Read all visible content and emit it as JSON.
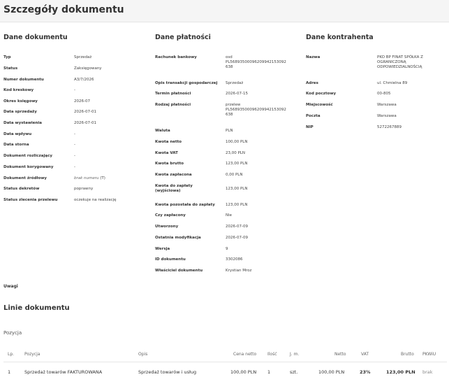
{
  "page": {
    "title": "Szczegóły dokumentu"
  },
  "document": {
    "title": "Dane dokumentu",
    "fields": [
      {
        "label": "Typ",
        "value": "Sprzedaż"
      },
      {
        "label": "Status",
        "value": "Zaksięgowany"
      },
      {
        "label": "Numer dokumentu",
        "value": "A3/7/2026"
      },
      {
        "label": "Kod kreskowy",
        "value": "-"
      },
      {
        "label": "Okres księgowy",
        "value": "2026-07"
      },
      {
        "label": "Data sprzedaży",
        "value": "2026-07-01"
      },
      {
        "label": "Data wystawienia",
        "value": "2026-07-01"
      },
      {
        "label": "Data wpływu",
        "value": "-"
      },
      {
        "label": "Data storna",
        "value": "-"
      },
      {
        "label": "Dokument rozliczający",
        "value": "-"
      },
      {
        "label": "Dokument korygowany",
        "value": "-"
      },
      {
        "label": "Dokument źródłowy",
        "value_italic": "brak numeru",
        "value_suffix": " (T)"
      },
      {
        "label": "Status dekretów",
        "value": "poprawny"
      },
      {
        "label": "Status zlecenia przelewu",
        "value": "oczekuje na realizację"
      }
    ]
  },
  "payment": {
    "title": "Dane płatności",
    "fields": [
      {
        "label": "Rachunek bankowy",
        "value": [
          "osd",
          "PL56893500096209942153092",
          "638"
        ]
      },
      {
        "label": "Opis transakcji gospodarczej",
        "value": [
          "Sprzedaż"
        ]
      },
      {
        "label": "Termin płatności",
        "value": [
          "2026-07-15"
        ]
      },
      {
        "label": "Rodzaj płatności",
        "value": [
          "przelew",
          "PL56893500096209942153092",
          "638"
        ]
      },
      {
        "label": "Waluta",
        "value": [
          "PLN"
        ]
      },
      {
        "label": "Kwota netto",
        "value": [
          "100,00 PLN"
        ]
      },
      {
        "label": "Kwota VAT",
        "value": [
          "23,00 PLN"
        ]
      },
      {
        "label": "Kwota brutto",
        "value": [
          "123,00 PLN"
        ]
      },
      {
        "label": "Kwota zapłacona",
        "value": [
          "0,00 PLN"
        ]
      },
      {
        "label": "Kwota do zapłaty (wyjściowa)",
        "value": [
          "123,00 PLN"
        ]
      },
      {
        "label": "Kwota pozostała do zapłaty",
        "value": [
          "123,00 PLN"
        ]
      },
      {
        "label": "Czy zapłacony",
        "value": [
          "Nie"
        ]
      },
      {
        "label": "Utworzony",
        "value": [
          "2026-07-09"
        ]
      },
      {
        "label": "Ostatnia modyfikacja",
        "value": [
          "2026-07-09"
        ]
      },
      {
        "label": "Wersja",
        "value": [
          "9"
        ]
      },
      {
        "label": "ID dokumentu",
        "value": [
          "3302086"
        ]
      },
      {
        "label": "Właściciel dokumentu",
        "value": [
          "Krystian Mroz"
        ]
      }
    ]
  },
  "contractor": {
    "title": "Dane kontrahenta",
    "fields": [
      {
        "label": "Nazwa",
        "value": [
          "PKO BP FINAT SPÓŁKA Z",
          "OGRANICZONĄ",
          "ODPOWIEDZIALNOŚCIĄ"
        ]
      },
      {
        "label": "Adres",
        "value": [
          "ul. Chmielna 89"
        ]
      },
      {
        "label": "Kod pocztowy",
        "value": [
          "00-805"
        ]
      },
      {
        "label": "Miejscowość",
        "value": [
          "Warszawa"
        ]
      },
      {
        "label": "Poczta",
        "value": [
          "Warszawa"
        ]
      },
      {
        "label": "NIP",
        "value": [
          "5272267889"
        ]
      }
    ]
  },
  "notes": {
    "label": "Uwagi"
  },
  "lines": {
    "title": "Linie dokumentu",
    "subtitle": "Pozycja",
    "columns": {
      "lp": "Lp.",
      "position": "Pozycja",
      "description": "Opis",
      "net_price": "Cena netto",
      "qty": "Ilość",
      "unit": "J. m.",
      "net": "Netto",
      "vat": "VAT",
      "gross": "Brutto",
      "pkwiu": "PKWiU"
    },
    "rows": [
      {
        "lp": "1",
        "position": "Sprzedaż towarów FAKTUROWANA",
        "description": "Sprzedaż towarów i usług",
        "net_price": "100,00 PLN",
        "qty": "1",
        "unit": "szt.",
        "net": "100,00 PLN",
        "vat": "23%",
        "gross": "123,00 PLN",
        "pkwiu": "brak"
      }
    ]
  }
}
